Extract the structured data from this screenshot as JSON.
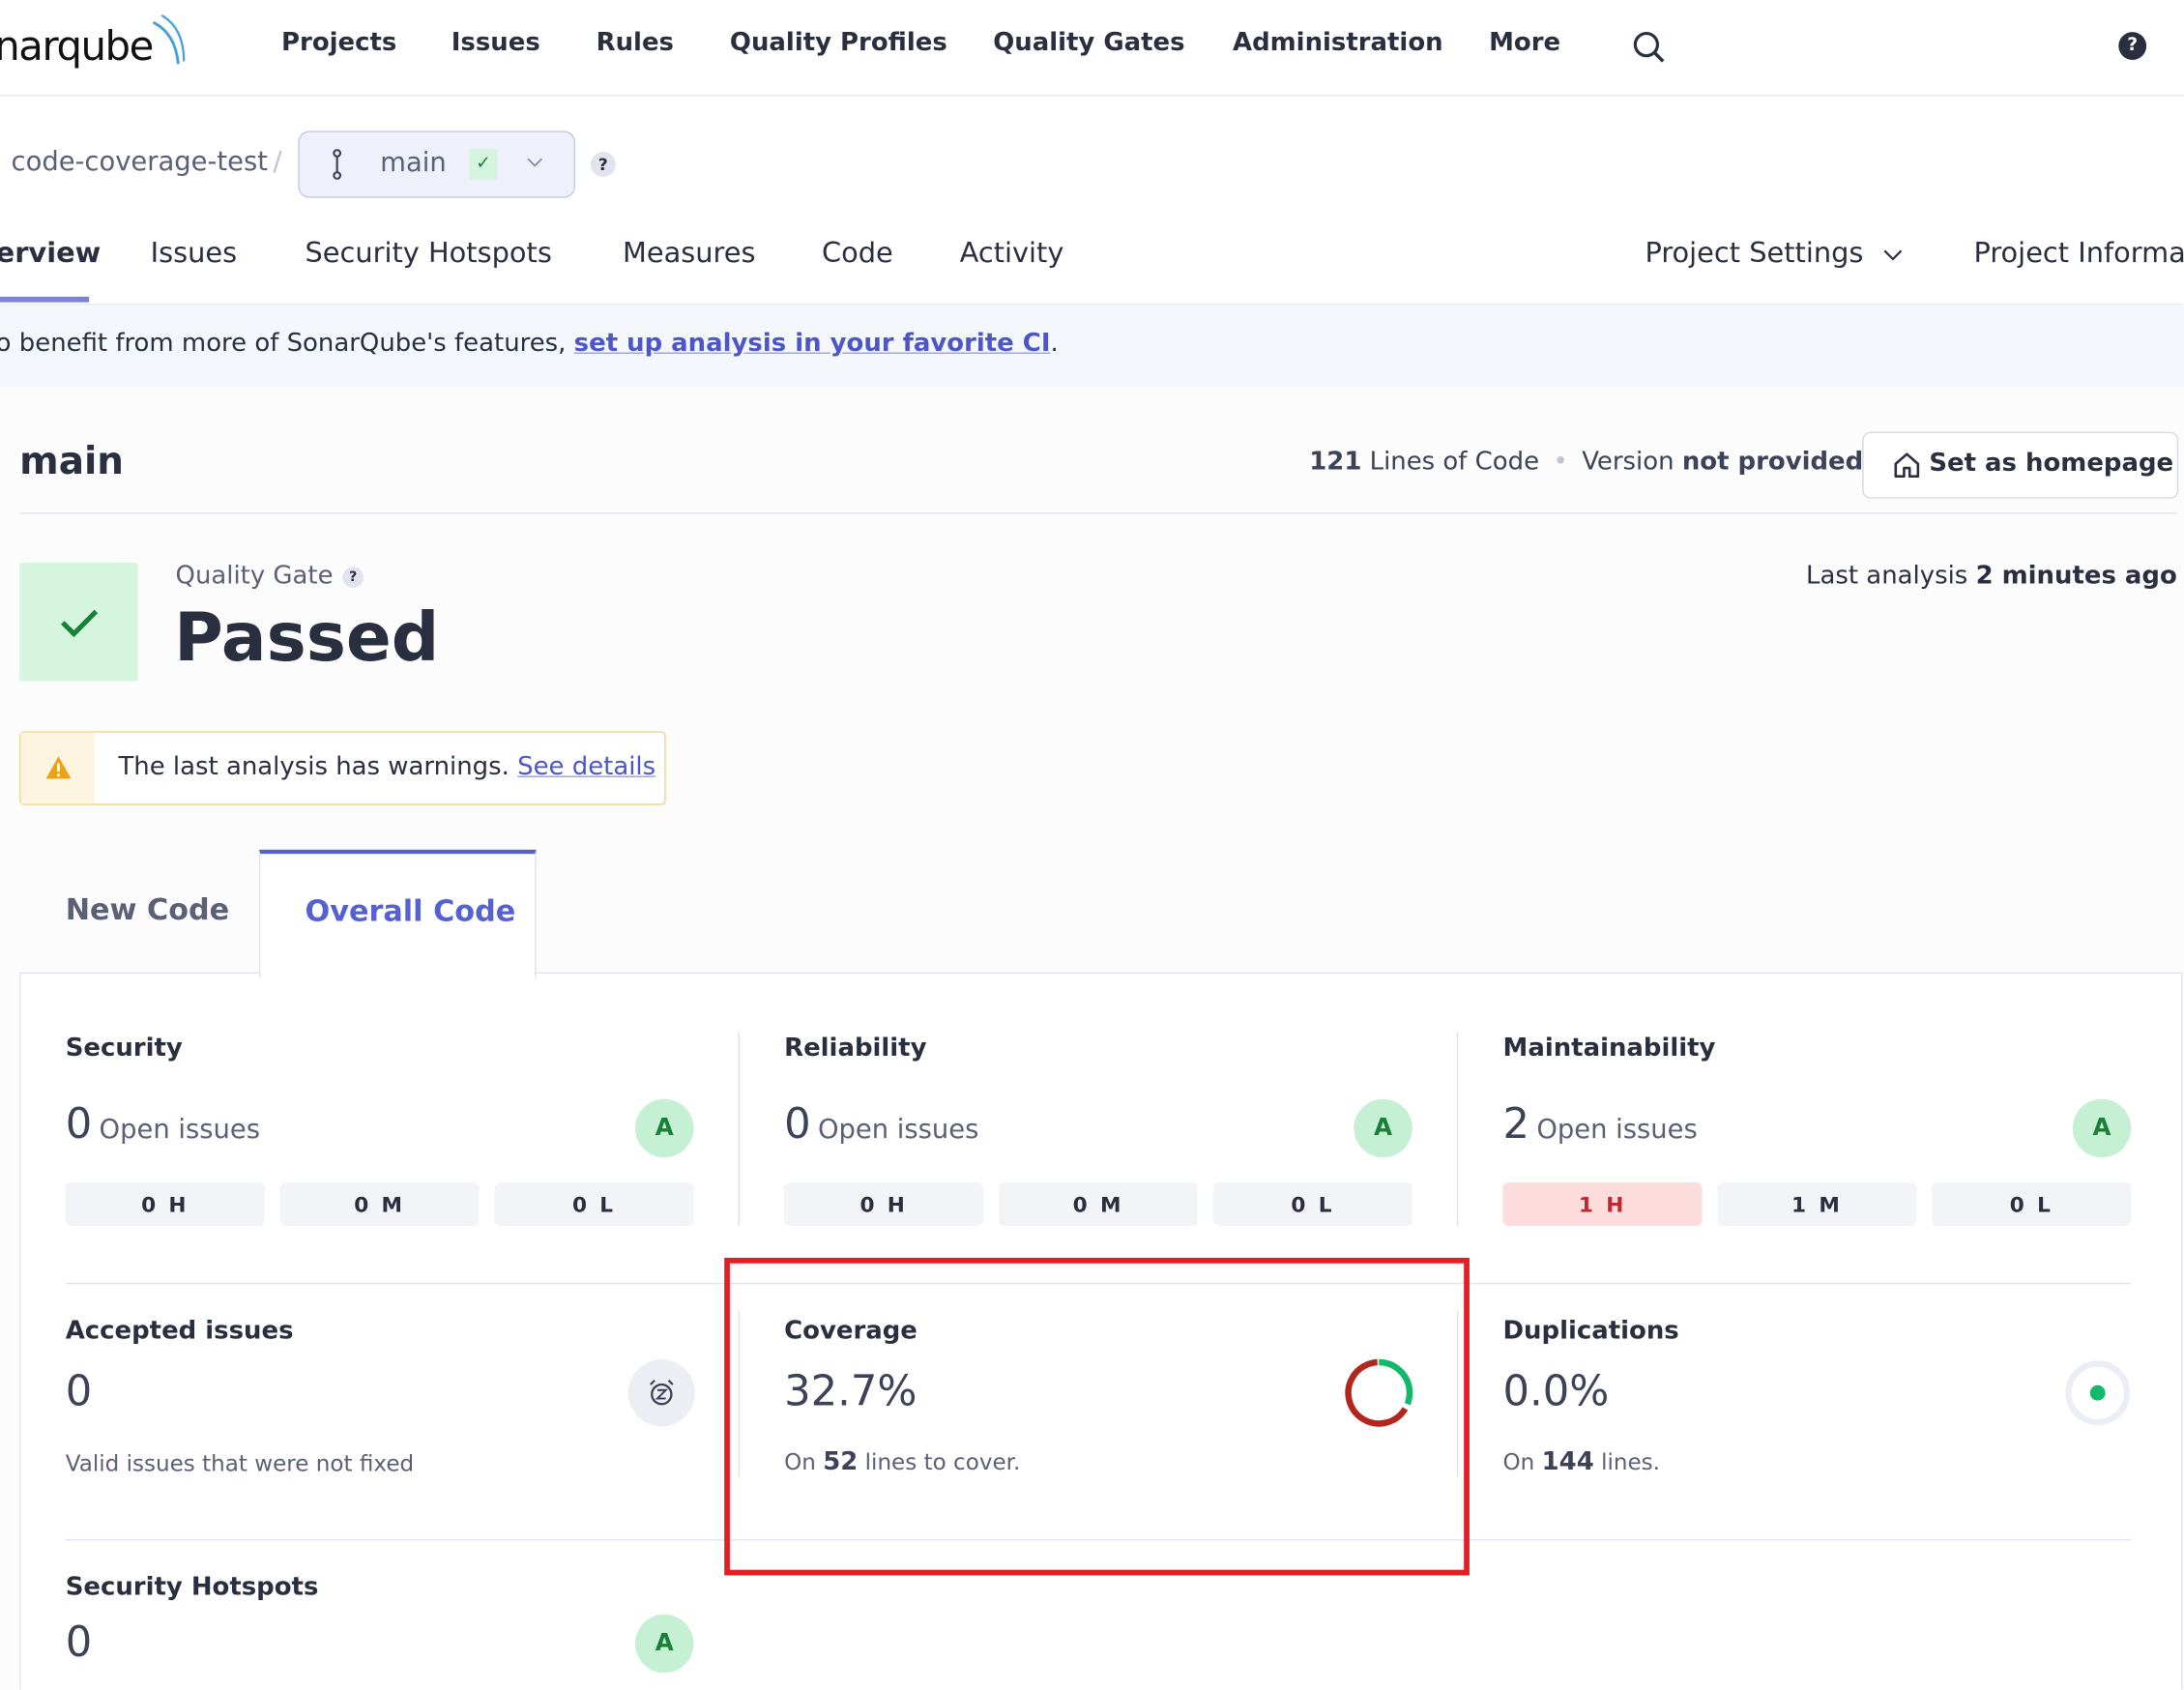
{
  "nav": {
    "logo": "narqube",
    "items": [
      "Projects",
      "Issues",
      "Rules",
      "Quality Profiles",
      "Quality Gates",
      "Administration",
      "More"
    ]
  },
  "breadcrumb": {
    "project": "code-coverage-test",
    "separator": "/",
    "branch": "main"
  },
  "tabs": [
    "erview",
    "Issues",
    "Security Hotspots",
    "Measures",
    "Code",
    "Activity"
  ],
  "tabs_right": {
    "settings": "Project Settings",
    "info": "Project Informa"
  },
  "banner": {
    "text": "o benefit from more of SonarQube's features, ",
    "link": "set up analysis in your favorite CI",
    "end": "."
  },
  "header": {
    "title": "main",
    "loc_num": "121",
    "loc_label": " Lines of Code",
    "version_label": "Version ",
    "version_value": "not provided",
    "homepage_button": "Set as homepage"
  },
  "quality_gate": {
    "label": "Quality Gate",
    "status": "Passed",
    "last_label": "Last analysis ",
    "last_value": "2 minutes ago"
  },
  "warning": {
    "text": "The last analysis has warnings. ",
    "link": "See details"
  },
  "code_tabs": {
    "new": "New Code",
    "overall": "Overall Code"
  },
  "metrics": {
    "security": {
      "title": "Security",
      "count": "0",
      "label": "Open issues",
      "grade": "A",
      "pills": [
        "0 H",
        "0 M",
        "0 L"
      ]
    },
    "reliability": {
      "title": "Reliability",
      "count": "0",
      "label": "Open issues",
      "grade": "A",
      "pills": [
        "0 H",
        "0 M",
        "0 L"
      ]
    },
    "maintainability": {
      "title": "Maintainability",
      "count": "2",
      "label": "Open issues",
      "grade": "A",
      "pills": [
        "1 H",
        "1 M",
        "0 L"
      ]
    },
    "accepted": {
      "title": "Accepted issues",
      "value": "0",
      "sub": "Valid issues that were not fixed"
    },
    "coverage": {
      "title": "Coverage",
      "value": "32.7%",
      "percent": 32.7,
      "sub_pre": "On ",
      "sub_num": "52",
      "sub_post": " lines to cover."
    },
    "duplications": {
      "title": "Duplications",
      "value": "0.0%",
      "sub_pre": "On ",
      "sub_num": "144",
      "sub_post": " lines."
    },
    "hotspots": {
      "title": "Security Hotspots",
      "value": "0",
      "grade": "A"
    }
  },
  "colors": {
    "accent": "#5661d0",
    "pass": "#1a7f37",
    "fail": "#b3261e",
    "highlight": "#e31e24"
  }
}
